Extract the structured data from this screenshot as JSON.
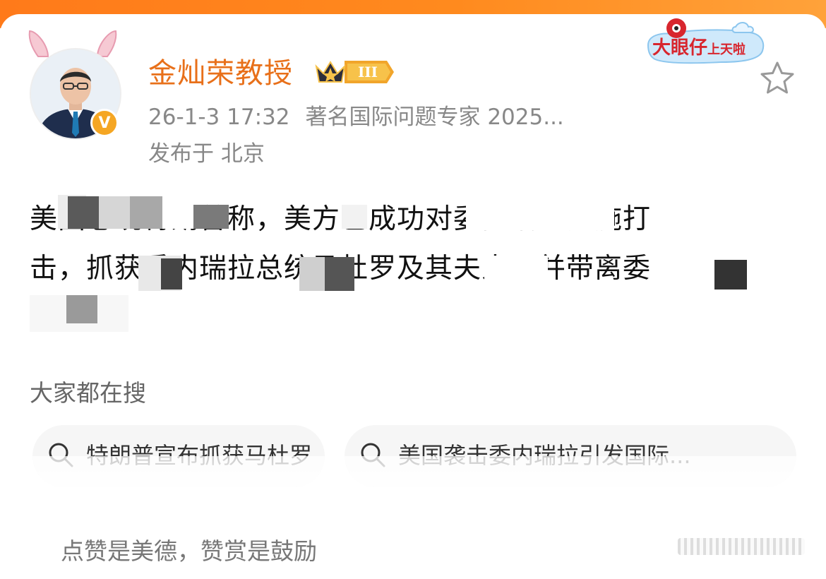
{
  "post": {
    "author_name": "金灿荣教授",
    "rank_label": "III",
    "timestamp": "26-1-3 17:32",
    "author_title": "著名国际问题专家 2025...",
    "location": "发布于 北京",
    "body_line1": "美国总统特朗普称，美方已成功对委内瑞拉实施打",
    "body_line2": "击，抓获委内瑞拉总统马杜罗及其夫人，并带离委",
    "body_line3": "内瑞拉。",
    "verified_mark": "V"
  },
  "promo": {
    "main": "大眼仔",
    "sub": "上天啦"
  },
  "hot_search": {
    "title": "大家都在搜",
    "items": [
      {
        "label": "特朗普宣布抓获马杜罗"
      },
      {
        "label": "美国袭击委内瑞拉引发国际..."
      }
    ]
  },
  "footer": {
    "text": "点赞是美德，赞赏是鼓励"
  },
  "colors": {
    "accent": "#e8701a",
    "top_strip": "#ff7a1a",
    "verified": "#f5a623",
    "promo_red": "#d8262e"
  }
}
